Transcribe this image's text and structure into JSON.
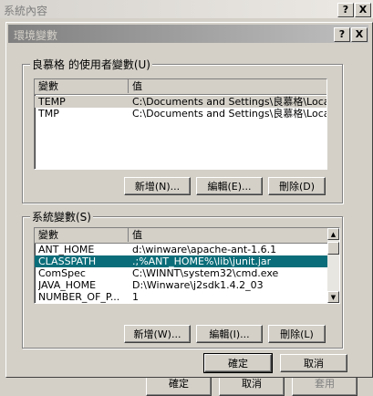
{
  "outer": {
    "title": "系統內容",
    "help_btn": "?",
    "close_btn": "X",
    "buttons": [
      "確定",
      "取消",
      "套用"
    ]
  },
  "dialog": {
    "title": "環境變數",
    "help_btn": "?",
    "close_btn": "X",
    "user_section": {
      "label": "良慕格 的使用者變數(U)",
      "col_var": "變數",
      "col_val": "值",
      "rows": [
        {
          "name": "TEMP",
          "value": "C:\\Documents and Settings\\良慕格\\Local ..."
        },
        {
          "name": "TMP",
          "value": "C:\\Documents and Settings\\良慕格\\Local ..."
        }
      ],
      "new_btn": "新增(N)...",
      "edit_btn": "編輯(E)...",
      "delete_btn": "刪除(D)"
    },
    "system_section": {
      "label": "系統變數(S)",
      "col_var": "變數",
      "col_val": "值",
      "rows": [
        {
          "name": "ANT_HOME",
          "value": "d:\\winware\\apache-ant-1.6.1"
        },
        {
          "name": "CLASSPATH",
          "value": ".;%ANT_HOME%\\lib\\junit.jar"
        },
        {
          "name": "ComSpec",
          "value": "C:\\WINNT\\system32\\cmd.exe"
        },
        {
          "name": "JAVA_HOME",
          "value": "D:\\Winware\\j2sdk1.4.2_03"
        },
        {
          "name": "NUMBER_OF_P...",
          "value": "1"
        }
      ],
      "new_btn": "新增(W)...",
      "edit_btn": "編輯(I)...",
      "delete_btn": "刪除(L)"
    },
    "ok_btn": "確定",
    "cancel_btn": "取消"
  },
  "colors": {
    "selection": "#0a6d79",
    "face": "#d4d0c8"
  }
}
